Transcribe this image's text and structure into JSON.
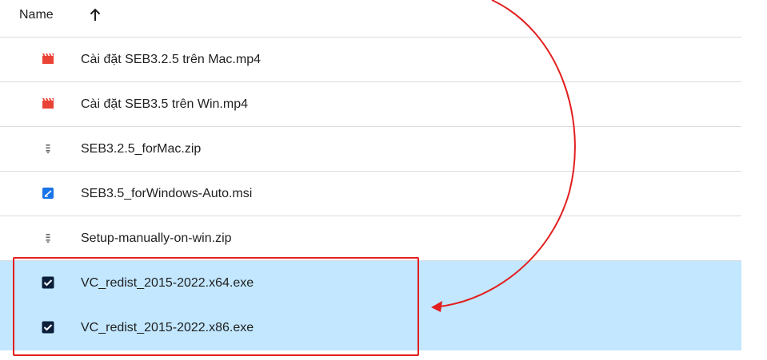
{
  "header": {
    "column_name": "Name",
    "sort_icon": "arrow-up-icon"
  },
  "files": [
    {
      "name": "Cài đặt SEB3.2.5 trên Mac.mp4",
      "icon": "video-icon",
      "selected": false
    },
    {
      "name": "Cài đặt SEB3.5 trên Win.mp4",
      "icon": "video-icon",
      "selected": false
    },
    {
      "name": "SEB3.2.5_forMac.zip",
      "icon": "zip-icon",
      "selected": false
    },
    {
      "name": "SEB3.5_forWindows-Auto.msi",
      "icon": "msi-icon",
      "selected": false
    },
    {
      "name": "Setup-manually-on-win.zip",
      "icon": "zip-icon",
      "selected": false
    },
    {
      "name": "VC_redist_2015-2022.x64.exe",
      "icon": "checkbox-checked-icon",
      "selected": true
    },
    {
      "name": "VC_redist_2015-2022.x86.exe",
      "icon": "checkbox-checked-icon",
      "selected": true
    }
  ],
  "colors": {
    "selected_row": "#c2e7ff",
    "annotation": "#e21f1f",
    "video_icon": "#ea4335",
    "msi_icon": "#1a73e8",
    "checkbox": "#0b1f3a"
  }
}
